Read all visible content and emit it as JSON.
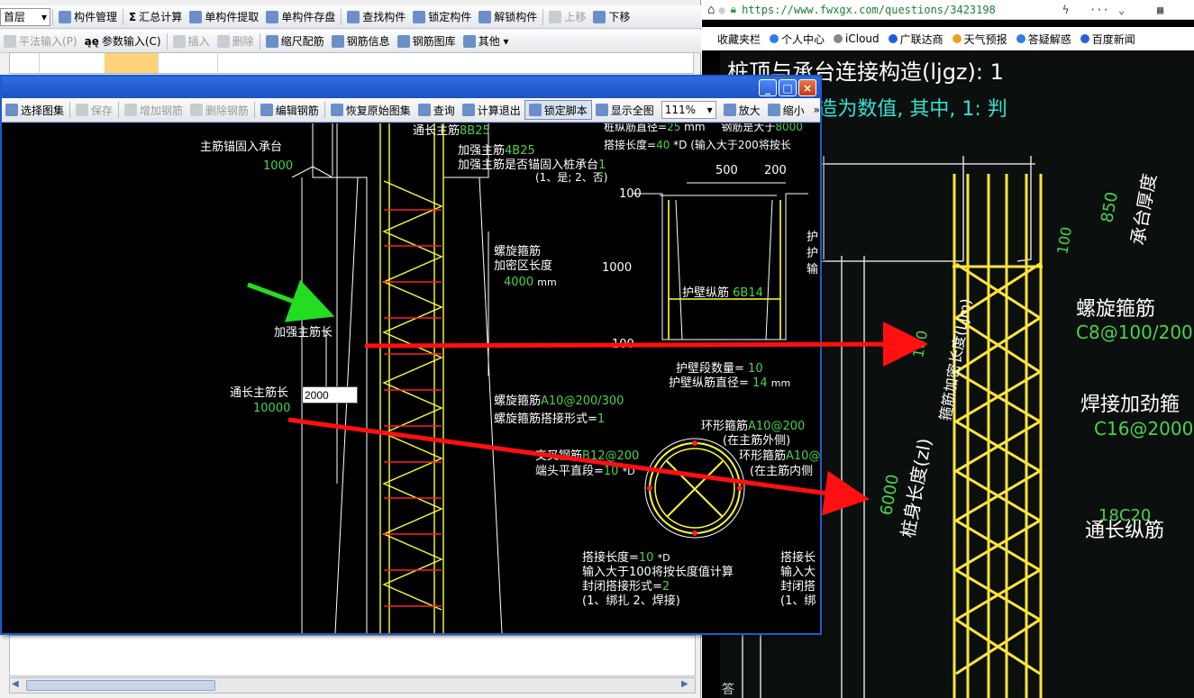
{
  "bg_app": {
    "floor_select": "首层",
    "toolbar1": [
      {
        "label": "构件管理",
        "icon": "list-icon"
      },
      {
        "label": "汇总计算",
        "icon": "sigma-icon",
        "prefix": "Σ"
      },
      {
        "label": "单构件提取",
        "icon": "extract-icon"
      },
      {
        "label": "单构件存盘",
        "icon": "save-icon"
      },
      {
        "label": "查找构件",
        "icon": "binoculars-icon"
      },
      {
        "label": "锁定构件",
        "icon": "lock-icon"
      },
      {
        "label": "解锁构件",
        "icon": "unlock-icon"
      },
      {
        "label": "上移",
        "icon": "up-icon",
        "dim": true
      },
      {
        "label": "下移",
        "icon": "down-icon"
      }
    ],
    "toolbar2": [
      {
        "label": "平法输入(P)",
        "icon": "grid-icon",
        "dim": true
      },
      {
        "label": "参数输入(C)",
        "icon": "param-icon",
        "prefix": "ąę"
      },
      {
        "label": "插入",
        "icon": "insert-icon",
        "dim": true
      },
      {
        "label": "删除",
        "icon": "delete-icon",
        "dim": true
      },
      {
        "label": "缩尺配筋",
        "icon": "ruler-icon"
      },
      {
        "label": "钢筋信息",
        "icon": "info-icon"
      },
      {
        "label": "钢筋图库",
        "icon": "library-icon"
      },
      {
        "label": "其他",
        "icon": "other-icon",
        "suffix": "▾"
      }
    ]
  },
  "browser": {
    "url": "https://www.fwxgx.com/questions/3423198",
    "bookmarks": [
      "收藏夹栏",
      "个人中心",
      "iCloud",
      "广联达商",
      "天气预报",
      "答疑解惑",
      "百度新闻"
    ],
    "photo_texts": {
      "title": "桩顶与承台连接构造(ljgz): 1",
      "note": "注: 连接构造为数值, 其中, 1: 判",
      "cap_thickness": "承台厚度",
      "dim_850": "850",
      "dim_100_top": "100",
      "dim_100_side": "100",
      "dense_zone": "箍筋加密长度(Ljm)",
      "spiral": "螺旋箍筋",
      "spiral_spec": "C8@100/200",
      "welded": "焊接加劲箍",
      "welded_spec": "C16@2000",
      "pile_len": "桩身长度(zl)",
      "pile_len_value": "6000",
      "long_bar_spec": "18C20",
      "long_bar": "通长纵筋",
      "footer": "答"
    }
  },
  "dialog": {
    "controls": [
      "_",
      "□",
      "×"
    ],
    "toolbar": [
      {
        "label": "选择图集",
        "icon": "select-icon"
      },
      {
        "label": "保存",
        "icon": "save-icon",
        "dim": true
      },
      {
        "label": "增加钢筋",
        "icon": "add-icon",
        "dim": true
      },
      {
        "label": "删除钢筋",
        "icon": "remove-icon",
        "dim": true
      },
      {
        "label": "编辑钢筋",
        "icon": "edit-icon"
      },
      {
        "label": "恢复原始图集",
        "icon": "restore-icon"
      },
      {
        "label": "查询",
        "icon": "binoculars-icon"
      },
      {
        "label": "计算退出",
        "icon": "fx-icon"
      },
      {
        "label": "锁定脚本",
        "icon": "lock-icon",
        "pressed": true
      },
      {
        "label": "显示全图",
        "icon": "fit-icon"
      },
      {
        "label": "放大",
        "icon": "zoom-in-icon"
      },
      {
        "label": "缩小",
        "icon": "zoom-out-icon"
      }
    ],
    "zoom": "111%",
    "more": "»",
    "input_value": "2000",
    "cad": {
      "t_top_long": "通长主筋",
      "t_top_long_val": "8B25",
      "t_anchor": "主筋锚固入承台",
      "t_anchor_val": "1000",
      "t_reinf_main": "加强主筋",
      "t_reinf_main_val": "4B25",
      "t_reinf_anchor": "加强主筋是否锚固入桩承台",
      "t_reinf_anchor_val": "1",
      "t_reinf_anchor_opts": "(1、是; 2、否)",
      "t_pile_dia": "桩纵筋直径=",
      "t_pile_dia_val": "25",
      "t_pile_dia_unit": "mm",
      "t_bar_gt": "钢筋是大于",
      "t_bar_gt_val": "8000",
      "t_lap_len": "搭接长度=",
      "t_lap_len_val": "40",
      "t_lap_len_note": "*D (输入大于200将按长",
      "t_d500": "500",
      "t_d200": "200",
      "t_d100a": "100",
      "t_d1000": "1000",
      "t_d100b": "100",
      "t_wall_bar": "护壁纵筋",
      "t_wall_bar_val": "6B14",
      "t_wall_cnt": "护壁段数量=",
      "t_wall_cnt_val": "10",
      "t_wall_dia": "护壁纵筋直径=",
      "t_wall_dia_val": "14",
      "t_wall_dia_unit": "mm",
      "t_hu1": "护",
      "t_hu2": "护",
      "t_shu": "输",
      "t_spiral": "螺旋箍筋",
      "t_dense": "加密区长度",
      "t_dense_val": "4000",
      "t_dense_unit": "mm",
      "t_reinf_len": "加强主筋长",
      "t_long_len": "通长主筋长",
      "t_long_len_val": "10000",
      "t_spiral2": "螺旋箍筋",
      "t_spiral2_val": "A10@200/300",
      "t_spiral_form": "螺旋箍筋搭接形式=",
      "t_spiral_form_val": "1",
      "t_ring_out": "环形箍筋",
      "t_ring_out_val": "A10@200",
      "t_ring_out_note": "(在主筋外侧)",
      "t_ring_in": "环形箍筋",
      "t_ring_in_val": "A10@",
      "t_ring_in_note": "(在主筋内侧",
      "t_cross": "交叉钢筋",
      "t_cross_val": "B12@200",
      "t_end_straight": "端头平直段=",
      "t_end_straight_val": "10",
      "t_end_unit": "*D",
      "t_lap2": "搭接长度=",
      "t_lap2_val": "10",
      "t_lap2_unit": "*D",
      "t_lap2_note": "输入大于100将按长度值计算",
      "t_closed": "封闭搭接形式=",
      "t_closed_val": "2",
      "t_closed_opts": "(1、绑扎  2、焊接)",
      "t_lap3": "搭接长",
      "t_lap3b": "输入大",
      "t_lap3c": "封闭搭",
      "t_lap3d": "(1、绑"
    }
  },
  "colors": {
    "cad_yellow": "#ffff33",
    "cad_red": "#ff2020",
    "cad_green": "#4cd24c",
    "arrow_red": "#ff1010",
    "arrow_green": "#22dd22",
    "title_blue": "#1d51c8"
  }
}
